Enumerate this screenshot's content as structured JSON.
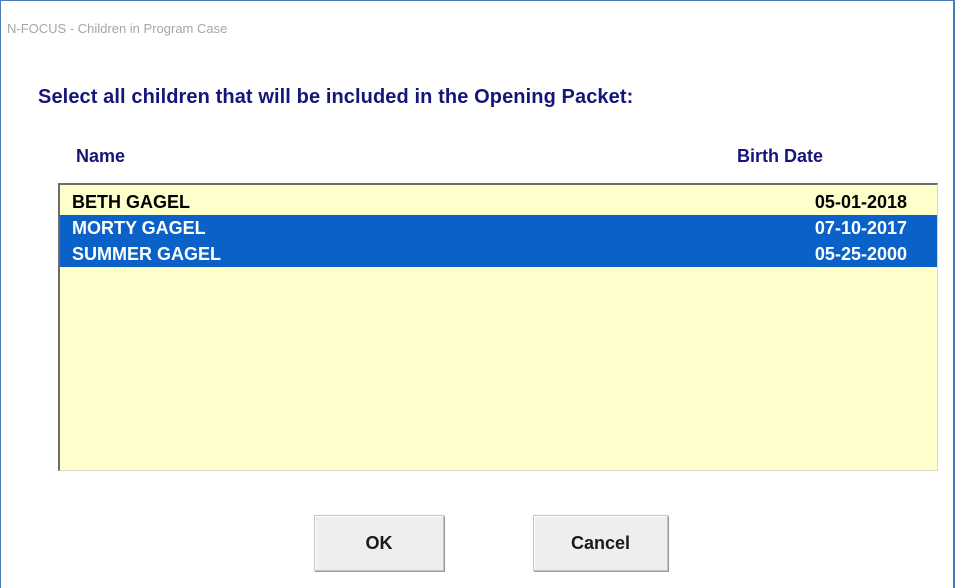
{
  "window": {
    "title": "N-FOCUS - Children in Program Case"
  },
  "prompt": "Select all children that will be included in the Opening Packet:",
  "list": {
    "headers": {
      "name": "Name",
      "birth_date": "Birth Date"
    },
    "rows": [
      {
        "name": "BETH GAGEL",
        "birth_date": "05-01-2018",
        "selected": false
      },
      {
        "name": "MORTY GAGEL",
        "birth_date": "07-10-2017",
        "selected": true
      },
      {
        "name": "SUMMER GAGEL",
        "birth_date": "05-25-2000",
        "selected": true
      }
    ]
  },
  "buttons": {
    "ok_label": "OK",
    "cancel_label": "Cancel"
  },
  "colors": {
    "list_background": "#ffffcc",
    "selection": "#0a62c8",
    "heading_text": "#16167a"
  }
}
